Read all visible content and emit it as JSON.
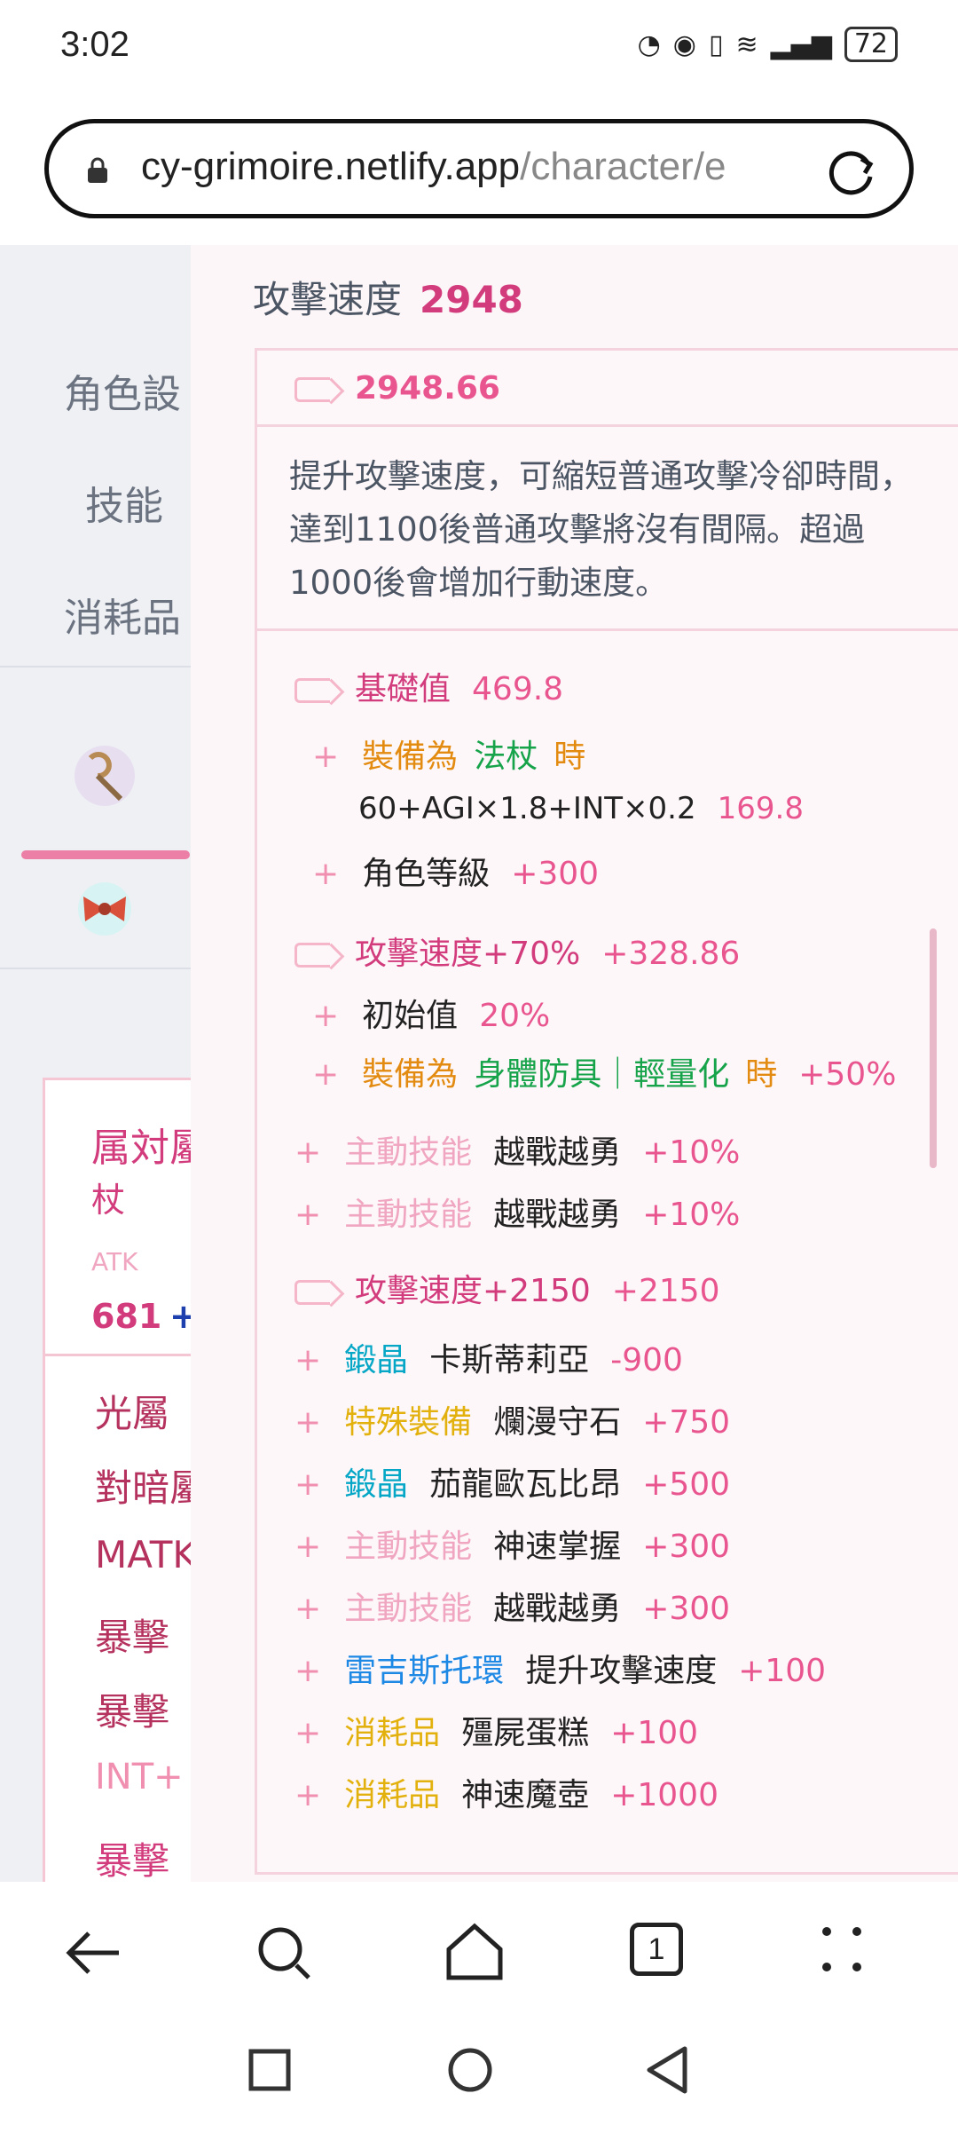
{
  "status": {
    "time": "3:02",
    "battery": "72"
  },
  "browser": {
    "url_domain": "cy-grimoire.netlify.app",
    "url_path": "/character/e",
    "tab_count": "1"
  },
  "sidenav": {
    "items": [
      "角色設",
      "技能",
      "消耗品"
    ]
  },
  "bg_card": {
    "title_line1": "属対屬",
    "title_line2": "杖",
    "atk_label": "ATK",
    "atk_value": "681",
    "atk_plus": "+",
    "lines": [
      "光屬",
      "對暗屬",
      "MATK",
      "暴擊",
      "暴擊",
      "INT+",
      "暴擊"
    ]
  },
  "panel": {
    "title": "攻擊速度",
    "title_value": "2948",
    "total": "2948.66",
    "description": "提升攻擊速度，可縮短普通攻擊冷卻時間，達到1100後普通攻擊將沒有間隔。超過1000後會增加行動速度。",
    "base": {
      "label": "基礎值",
      "value": "469.8",
      "equip_prefix": "裝備為",
      "equip_item": "法杖",
      "equip_suffix": "時",
      "formula": "60+AGI×1.8+INT×0.2",
      "formula_value": "169.8",
      "level_label": "角色等級",
      "level_value": "+300"
    },
    "rate": {
      "label": "攻擊速度+70%",
      "value": "+328.86",
      "init_label": "初始值",
      "init_value": "20%",
      "equip_prefix": "裝備為",
      "equip_item": "身體防具｜輕量化",
      "equip_suffix": "時",
      "equip_value": "+50%",
      "skills": [
        {
          "cat": "主動技能",
          "name": "越戰越勇",
          "value": "+10%"
        },
        {
          "cat": "主動技能",
          "name": "越戰越勇",
          "value": "+10%"
        }
      ]
    },
    "flat": {
      "label": "攻擊速度+2150",
      "value": "+2150",
      "items": [
        {
          "cat": "鍛晶",
          "name": "卡斯蒂莉亞",
          "value": "-900"
        },
        {
          "cat": "特殊裝備",
          "name": "爛漫守石",
          "value": "+750"
        },
        {
          "cat": "鍛晶",
          "name": "茄龍歐瓦比昂",
          "value": "+500"
        },
        {
          "cat": "主動技能",
          "name": "神速掌握",
          "value": "+300"
        },
        {
          "cat": "主動技能",
          "name": "越戰越勇",
          "value": "+300"
        },
        {
          "cat": "雷吉斯托環",
          "name": "提升攻擊速度",
          "value": "+100"
        },
        {
          "cat": "消耗品",
          "name": "殭屍蛋糕",
          "value": "+100"
        },
        {
          "cat": "消耗品",
          "name": "神速魔壺",
          "value": "+1000"
        }
      ]
    }
  },
  "colors": {
    "accent": "#d23b7c",
    "border": "#f4d3de"
  },
  "icons": [
    "lock-icon",
    "reload-icon",
    "staff-icon",
    "bow-ribbon-icon",
    "back-icon",
    "search-icon",
    "home-icon",
    "tabs-icon",
    "menu-icon",
    "square-icon",
    "circle-icon",
    "triangle-icon"
  ]
}
